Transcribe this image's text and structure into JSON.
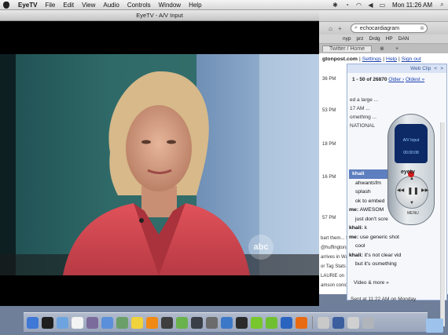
{
  "menubar": {
    "items": [
      "EyeTV",
      "File",
      "Edit",
      "View",
      "Audio",
      "Controls",
      "Window",
      "Help"
    ],
    "clock": "Mon 11:26 AM"
  },
  "player": {
    "title": "EyeTV - A/V Input",
    "channel_logo": "abc"
  },
  "browser": {
    "search_value": "echocardiagram",
    "bookmarks": [
      "nyp",
      "prz",
      "Drdg",
      "HP",
      "DAN"
    ],
    "tab_title": "Twitter / Home",
    "page_header": {
      "site": "gtonpost.com",
      "sep1": "|",
      "settings": "Settings",
      "sep2": "|",
      "help": "Help",
      "sep3": "|",
      "signout": "Sign out"
    },
    "timestamps": [
      "36 PM",
      "53 PM",
      "18 PM",
      "16 PM",
      "57 PM"
    ],
    "side_feed": [
      "bart them... Ser",
      "@huffingtonp",
      "arrives in Wa",
      "or Tag Stats A",
      "LAURIE on",
      "amson conion"
    ],
    "webclip": {
      "label": "Web Clip",
      "count_text": "1 - 50 of 26870",
      "older": "Older ›",
      "oldest": "Oldest »",
      "email_lines": [
        "ed a large ...",
        "17 AM ...",
        "omething ...",
        "NATIONAL"
      ]
    },
    "chat": [
      {
        "type": "highlight",
        "text": "khali"
      },
      {
        "type": "indent",
        "text": "ahwantsfm"
      },
      {
        "type": "indent",
        "text": "splash"
      },
      {
        "type": "indent",
        "text": "ok to embed"
      },
      {
        "type": "msg",
        "sender": "me:",
        "text": "AWESOM"
      },
      {
        "type": "indent",
        "text": "just don't scre"
      },
      {
        "type": "msg",
        "sender": "khali:",
        "text": "k"
      },
      {
        "type": "msg",
        "sender": "me:",
        "text": "use generic shot"
      },
      {
        "type": "indent",
        "text": "cool"
      },
      {
        "type": "msg",
        "sender": "khali:",
        "text": "it's not clear vid"
      },
      {
        "type": "indent",
        "text": "but it's osmething"
      }
    ],
    "sent_at": "Sent at 11:22 AM on Monday",
    "video_more": "Video & more »"
  },
  "remote": {
    "screen_title": "A/V Input",
    "screen_time": "00:00:08",
    "logo": "eyetv",
    "menu_label": "MENU"
  },
  "dock": {
    "icons": [
      "finder-icon",
      "dashboard-icon",
      "mail-icon",
      "calendar-icon",
      "photos-icon",
      "itunes-icon",
      "preview-icon",
      "stickies-icon",
      "vlc-icon",
      "imovie-icon",
      "alien-icon",
      "time-machine-icon",
      "system-prefs-icon",
      "compass-icon",
      "camera-icon",
      "swirl-green-icon",
      "swirl-green-2-icon",
      "vitals-icon",
      "firefox-icon",
      "script-icon",
      "stacks-icon",
      "printer-icon",
      "trash-icon"
    ],
    "colors": [
      "#3f78d6",
      "#1f1f1f",
      "#6da4e0",
      "#f3f3f3",
      "#7b6b9c",
      "#5b8fd9",
      "#6a9f6a",
      "#f0d23c",
      "#f08a14",
      "#3e3e3e",
      "#6ab24c",
      "#3a3f47",
      "#6b6b6b",
      "#3c78c8",
      "#2b2b2b",
      "#78c72c",
      "#6fc030",
      "#2a64c0",
      "#e86a12",
      "#c9c9c9",
      "#3b5e9e",
      "#d0d0d0",
      "#b0b5bc"
    ]
  }
}
